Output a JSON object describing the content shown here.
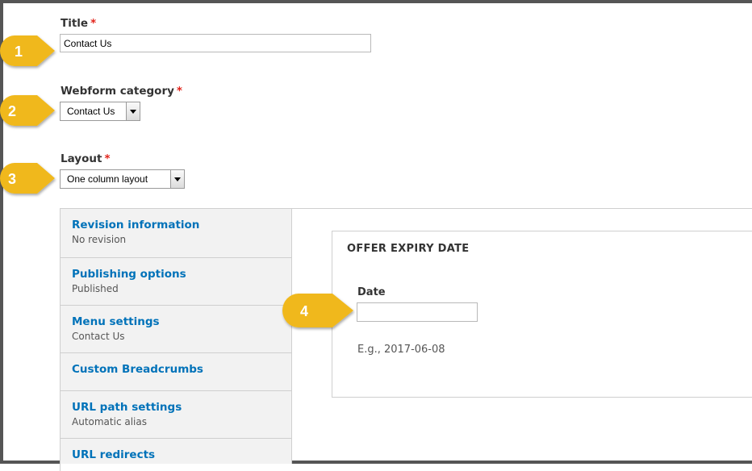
{
  "form": {
    "title": {
      "label": "Title",
      "required_mark": "*",
      "value": "Contact Us"
    },
    "webform_category": {
      "label": "Webform category",
      "required_mark": "*",
      "selected": "Contact Us"
    },
    "layout": {
      "label": "Layout",
      "required_mark": "*",
      "selected": "One column layout"
    }
  },
  "vertical_tabs": [
    {
      "title": "Revision information",
      "summary": "No revision"
    },
    {
      "title": "Publishing options",
      "summary": "Published"
    },
    {
      "title": "Menu settings",
      "summary": "Contact Us"
    },
    {
      "title": "Custom Breadcrumbs",
      "summary": ""
    },
    {
      "title": "URL path settings",
      "summary": "Automatic alias"
    },
    {
      "title": "URL redirects",
      "summary": ""
    }
  ],
  "offer_expiry": {
    "legend": "OFFER EXPIRY DATE",
    "date_label": "Date",
    "date_value": "",
    "description": "E.g., 2017-06-08"
  },
  "callouts": [
    "1",
    "2",
    "3",
    "4"
  ],
  "colors": {
    "callout": "#f0b81d",
    "link": "#0072b9",
    "required": "#e2231a"
  }
}
